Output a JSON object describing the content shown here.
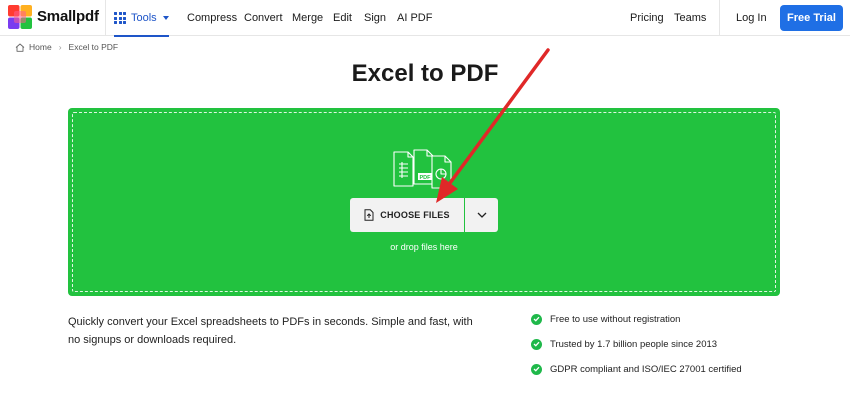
{
  "header": {
    "brand": "Smallpdf",
    "tools_label": "Tools",
    "nav": [
      "Compress",
      "Convert",
      "Merge",
      "Edit",
      "Sign",
      "AI PDF"
    ],
    "pricing": "Pricing",
    "teams": "Teams",
    "login": "Log In",
    "trial": "Free Trial"
  },
  "breadcrumb": {
    "home": "Home",
    "current": "Excel to PDF"
  },
  "page_title": "Excel to PDF",
  "dropzone": {
    "choose_label": "CHOOSE FILES",
    "drop_hint": "or drop files here",
    "icon_badge": "PDF",
    "color": "#22c23f"
  },
  "description": "Quickly convert your Excel spreadsheets to PDFs in seconds. Simple and fast, with no signups or downloads required.",
  "features": [
    "Free to use without registration",
    "Trusted by 1.7 billion people since 2013",
    "GDPR compliant and ISO/IEC 27001 certified"
  ],
  "colors": {
    "accent": "#1f6fe5",
    "drop_green": "#22c23f",
    "check_green": "#1fb84a",
    "annotation_arrow": "#e02828"
  }
}
